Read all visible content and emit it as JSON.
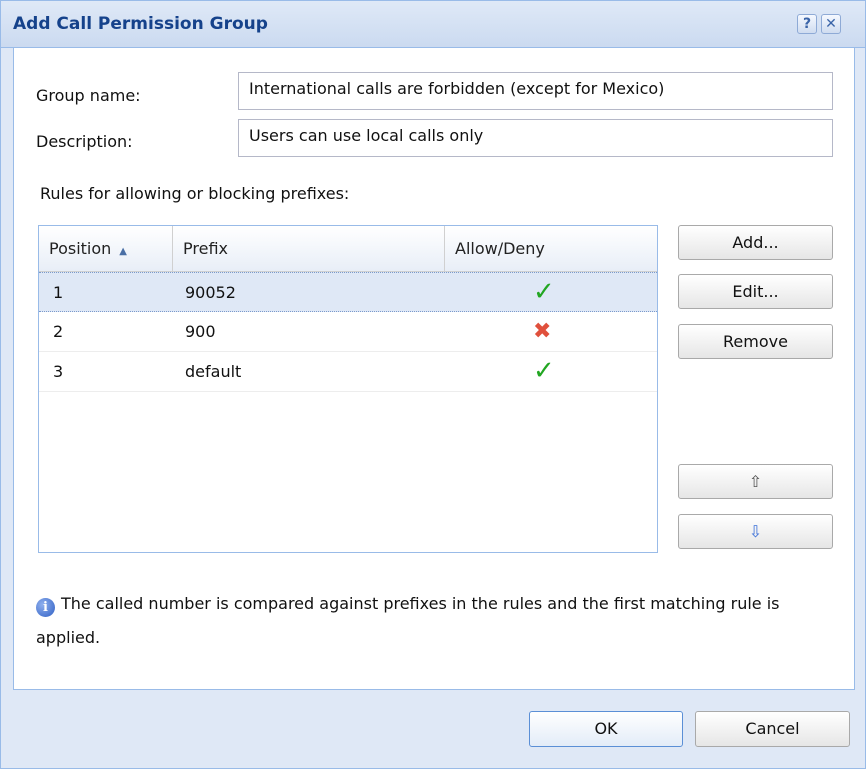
{
  "dialog": {
    "title": "Add Call Permission Group",
    "help_label": "?",
    "close_label": "✕"
  },
  "form": {
    "group_name_label": "Group name:",
    "group_name_value": "International calls are forbidden (except for Mexico)",
    "description_label": "Description:",
    "description_value": "Users can use local calls only",
    "rules_label": "Rules for allowing or blocking prefixes:"
  },
  "grid": {
    "columns": [
      "Position",
      "Prefix",
      "Allow/Deny"
    ],
    "sort_indicator": "▲",
    "rows": [
      {
        "position": "1",
        "prefix": "90052",
        "action": "allow",
        "icon": "check-icon",
        "glyph": "✓"
      },
      {
        "position": "2",
        "prefix": "900",
        "action": "deny",
        "icon": "cross-icon",
        "glyph": "✖"
      },
      {
        "position": "3",
        "prefix": "default",
        "action": "allow",
        "icon": "check-icon",
        "glyph": "✓"
      }
    ]
  },
  "side_buttons": {
    "add": "Add...",
    "edit": "Edit...",
    "remove": "Remove",
    "move_up": "⇧",
    "move_down": "⇩"
  },
  "info": {
    "icon_glyph": "i",
    "text": "The called number is compared against prefixes in the rules and the first matching rule is applied."
  },
  "footer": {
    "ok": "OK",
    "cancel": "Cancel"
  },
  "colors": {
    "allow": "#22a622",
    "deny": "#e0503c",
    "accent": "#15428b",
    "selection": "#dfe8f6"
  }
}
